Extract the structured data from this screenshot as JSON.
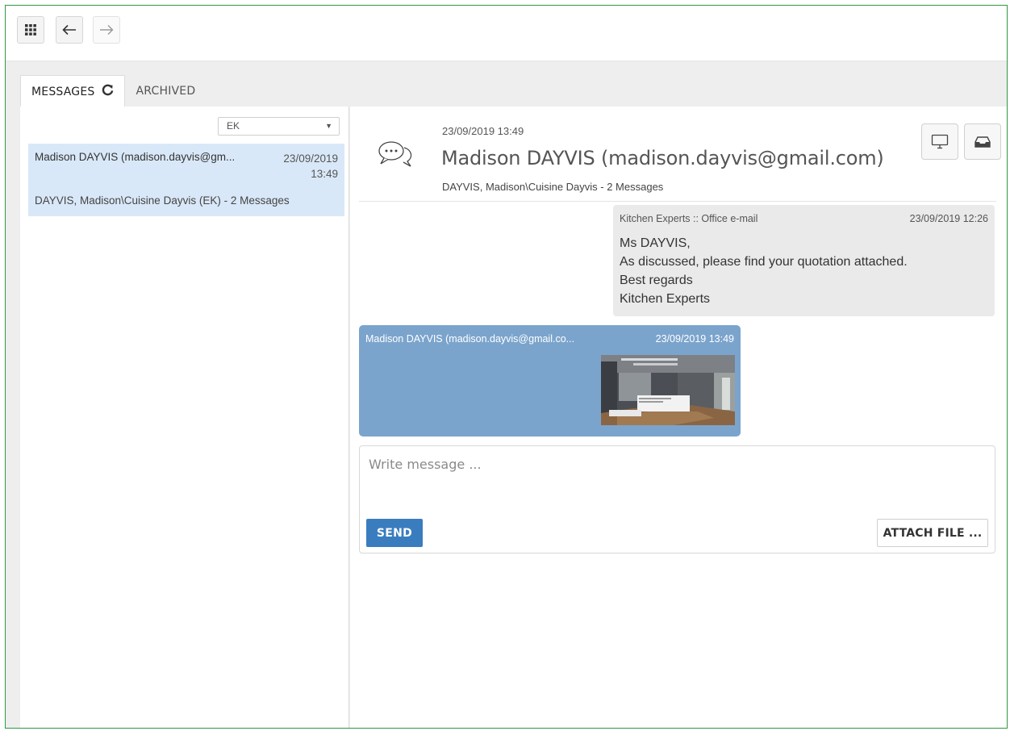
{
  "toolbar": {
    "apps_icon": "apps-grid-icon",
    "back_icon": "arrow-left-icon",
    "forward_icon": "arrow-right-icon"
  },
  "tabs": [
    {
      "label": "MESSAGES",
      "active": true,
      "icon": "refresh-icon"
    },
    {
      "label": "ARCHIVED",
      "active": false
    }
  ],
  "filter": {
    "selected": "EK"
  },
  "conversations": [
    {
      "contact": "Madison DAYVIS (madison.dayvis@gm...",
      "date": "23/09/2019",
      "time": "13:49",
      "subject": "DAYVIS, Madison\\Cuisine Dayvis (EK) - 2 Messages",
      "selected": true
    }
  ],
  "thread_header": {
    "datetime": "23/09/2019 13:49",
    "title": "Madison DAYVIS (madison.dayvis@gmail.com)",
    "subtitle": "DAYVIS, Madison\\Cuisine Dayvis - 2 Messages",
    "icon": "chat-bubbles-icon",
    "actions": [
      "monitor-icon",
      "inbox-icon"
    ]
  },
  "messages": [
    {
      "from": "Kitchen Experts :: Office e-mail",
      "time": "23/09/2019 12:26",
      "lines": [
        "Ms DAYVIS,",
        "As discussed, please find your quotation attached.",
        "Best regards",
        "Kitchen Experts"
      ],
      "direction": "incoming"
    },
    {
      "from": "Madison DAYVIS (madison.dayvis@gmail.co...",
      "time": "23/09/2019 13:49",
      "attachment": "kitchen-photo",
      "direction": "outgoing"
    }
  ],
  "composer": {
    "placeholder": "Write message ...",
    "send_label": "SEND",
    "attach_label": "ATTACH FILE ..."
  },
  "colors": {
    "frame_border": "#2e9a3f",
    "selected_conversation": "#d9e8f8",
    "outgoing_bubble": "#7ba4cd",
    "incoming_bubble": "#eaeaea",
    "send_button": "#3a7dbf"
  }
}
